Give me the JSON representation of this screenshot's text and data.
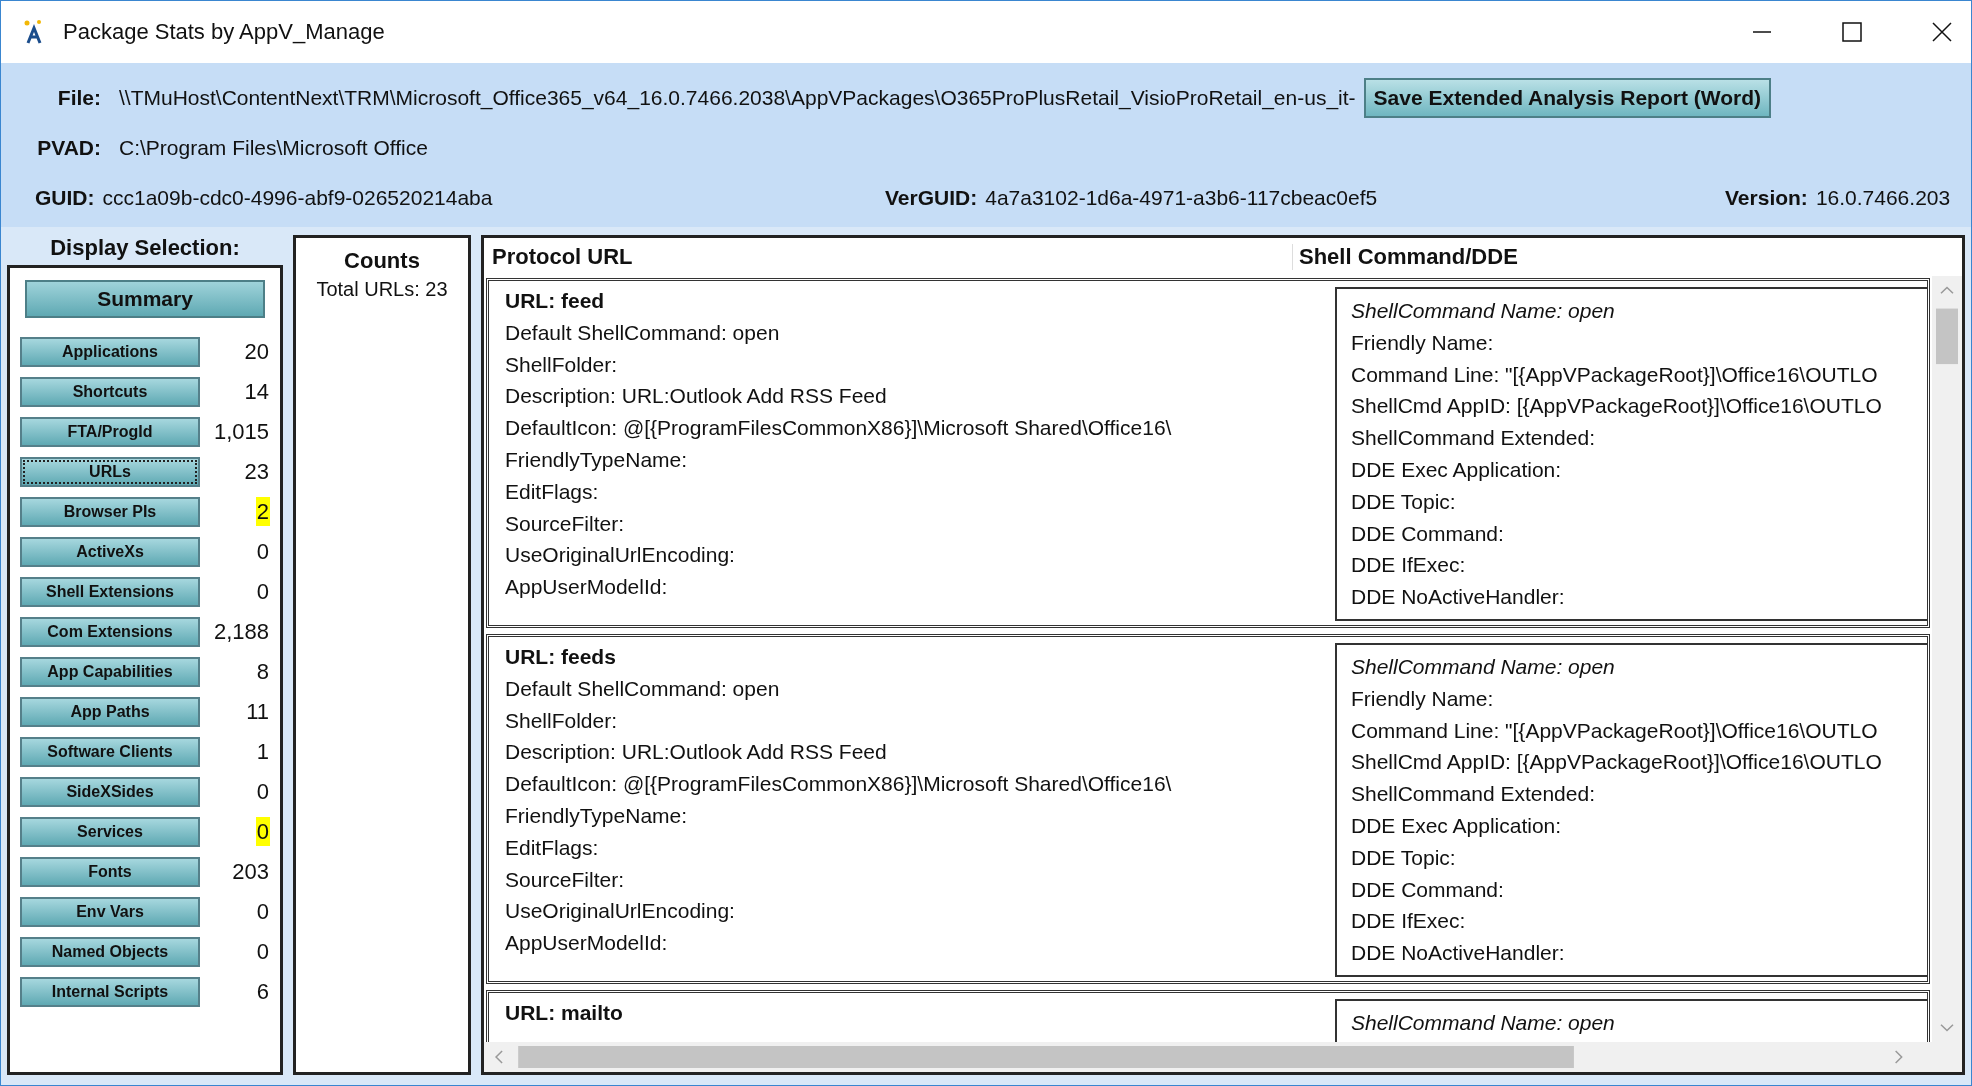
{
  "window": {
    "title": "Package Stats by AppV_Manage"
  },
  "header": {
    "fields": [
      {
        "label": "File:",
        "value": "\\\\TMuHost\\ContentNext\\TRM\\Microsoft_Office365_v64_16.0.7466.2038\\AppVPackages\\O365ProPlusRetail_VisioProRetail_en-us_it-"
      },
      {
        "label": "PVAD:",
        "value": "C:\\Program Files\\Microsoft Office"
      }
    ],
    "ids": [
      {
        "label": "GUID:",
        "value": "ccc1a09b-cdc0-4996-abf9-026520214aba"
      },
      {
        "label": "VerGUID:",
        "value": "4a7a3102-1d6a-4971-a3b6-117cbeac0ef5"
      },
      {
        "label": "Version:",
        "value": "16.0.7466.203"
      }
    ],
    "save_button": "Save Extended Analysis Report (Word)"
  },
  "display_selection": {
    "title": "Display Selection:",
    "summary_button": "Summary",
    "items": [
      {
        "label": "Applications",
        "count": "20",
        "selected": false,
        "highlight": false
      },
      {
        "label": "Shortcuts",
        "count": "14",
        "selected": false,
        "highlight": false
      },
      {
        "label": "FTA/ProgId",
        "count": "1,015",
        "selected": false,
        "highlight": false
      },
      {
        "label": "URLs",
        "count": "23",
        "selected": true,
        "highlight": false
      },
      {
        "label": "Browser PIs",
        "count": "2",
        "selected": false,
        "highlight": true
      },
      {
        "label": "ActiveXs",
        "count": "0",
        "selected": false,
        "highlight": false
      },
      {
        "label": "Shell Extensions",
        "count": "0",
        "selected": false,
        "highlight": false
      },
      {
        "label": "Com Extensions",
        "count": "2,188",
        "selected": false,
        "highlight": false
      },
      {
        "label": "App Capabilities",
        "count": "8",
        "selected": false,
        "highlight": false
      },
      {
        "label": "App Paths",
        "count": "11",
        "selected": false,
        "highlight": false
      },
      {
        "label": "Software Clients",
        "count": "1",
        "selected": false,
        "highlight": false
      },
      {
        "label": "SideXSides",
        "count": "0",
        "selected": false,
        "highlight": false
      },
      {
        "label": "Services",
        "count": "0",
        "selected": false,
        "highlight": true
      },
      {
        "label": "Fonts",
        "count": "203",
        "selected": false,
        "highlight": false
      },
      {
        "label": "Env Vars",
        "count": "0",
        "selected": false,
        "highlight": false
      },
      {
        "label": "Named Objects",
        "count": "0",
        "selected": false,
        "highlight": false
      },
      {
        "label": "Internal Scripts",
        "count": "6",
        "selected": false,
        "highlight": false
      }
    ]
  },
  "counts": {
    "title": "Counts",
    "lines": [
      "Total URLs: 23"
    ]
  },
  "table": {
    "columns": [
      "Protocol URL",
      "Shell Command/DDE"
    ],
    "rows": [
      {
        "url": "URL: feed",
        "details": [
          "Default ShellCommand: open",
          "ShellFolder:",
          "Description: URL:Outlook Add RSS Feed",
          "DefaultIcon: @[{ProgramFilesCommonX86}]\\Microsoft Shared\\Office16\\",
          "FriendlyTypeName:",
          "EditFlags:",
          "SourceFilter:",
          "UseOriginalUrlEncoding:",
          "AppUserModelId:"
        ],
        "command_name": "ShellCommand Name: open",
        "command_details": [
          "Friendly Name:",
          "Command Line: \"[{AppVPackageRoot}]\\Office16\\OUTLO",
          "ShellCmd AppID: [{AppVPackageRoot}]\\Office16\\OUTLO",
          "ShellCommand Extended:",
          "DDE Exec Application:",
          "DDE Topic:",
          "DDE Command:",
          "DDE IfExec:",
          "DDE NoActiveHandler:"
        ]
      },
      {
        "url": "URL: feeds",
        "details": [
          "Default ShellCommand: open",
          "ShellFolder:",
          "Description: URL:Outlook Add RSS Feed",
          "DefaultIcon: @[{ProgramFilesCommonX86}]\\Microsoft Shared\\Office16\\",
          "FriendlyTypeName:",
          "EditFlags:",
          "SourceFilter:",
          "UseOriginalUrlEncoding:",
          "AppUserModelId:"
        ],
        "command_name": "ShellCommand Name: open",
        "command_details": [
          "Friendly Name:",
          "Command Line: \"[{AppVPackageRoot}]\\Office16\\OUTLO",
          "ShellCmd AppID: [{AppVPackageRoot}]\\Office16\\OUTLO",
          "ShellCommand Extended:",
          "DDE Exec Application:",
          "DDE Topic:",
          "DDE Command:",
          "DDE IfExec:",
          "DDE NoActiveHandler:"
        ]
      },
      {
        "url": "URL: mailto",
        "details": [],
        "command_name": "ShellCommand Name: open",
        "command_details": []
      }
    ]
  }
}
